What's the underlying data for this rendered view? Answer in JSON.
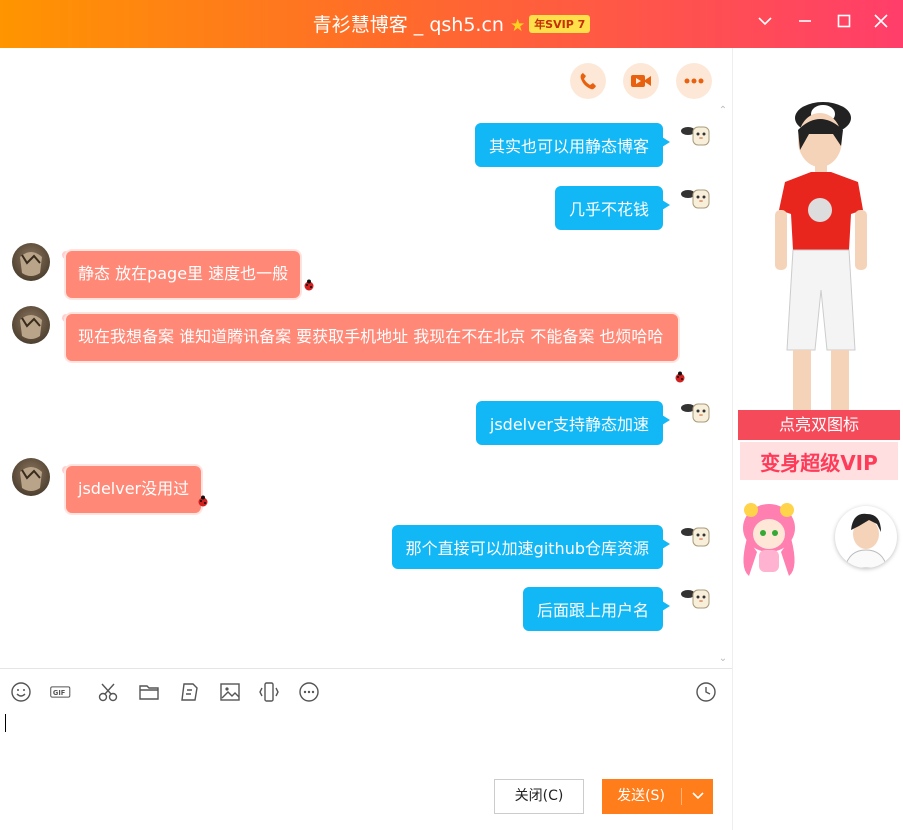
{
  "window": {
    "title": "青衫慧博客 _ qsh5.cn",
    "vip_badge": "年SVIP 7"
  },
  "messages": [
    {
      "side": "right",
      "text": "其实也可以用静态博客"
    },
    {
      "side": "right",
      "text": "几乎不花钱"
    },
    {
      "side": "left",
      "text": "静态 放在page里 速度也一般"
    },
    {
      "side": "left",
      "text": "现在我想备案 谁知道腾讯备案 要获取手机地址 我现在不在北京 不能备案 也烦哈哈"
    },
    {
      "side": "right",
      "text": "jsdelver支持静态加速"
    },
    {
      "side": "left",
      "text": "jsdelver没用过"
    },
    {
      "side": "right",
      "text": "那个直接可以加速github仓库资源"
    },
    {
      "side": "right",
      "text": "后面跟上用户名"
    }
  ],
  "buttons": {
    "close": "关闭(C)",
    "send": "发送(S)"
  },
  "side_panel": {
    "banner_line1": "点亮双图标",
    "banner_line2": "变身超级VIP"
  },
  "colors": {
    "title_gradient_start": "#ff9500",
    "title_gradient_end": "#ff3e6a",
    "outgoing_bubble": "#12b7f5",
    "incoming_bubble": "#ff8877",
    "send_button": "#ff7d1a"
  },
  "icons": {
    "toolbar": [
      "emoji-icon",
      "gif-icon",
      "scissors-icon",
      "folder-icon",
      "document-icon",
      "image-icon",
      "shake-icon",
      "more-icon",
      "history-icon"
    ],
    "top": [
      "phone-icon",
      "video-icon",
      "more-dots-icon"
    ]
  }
}
